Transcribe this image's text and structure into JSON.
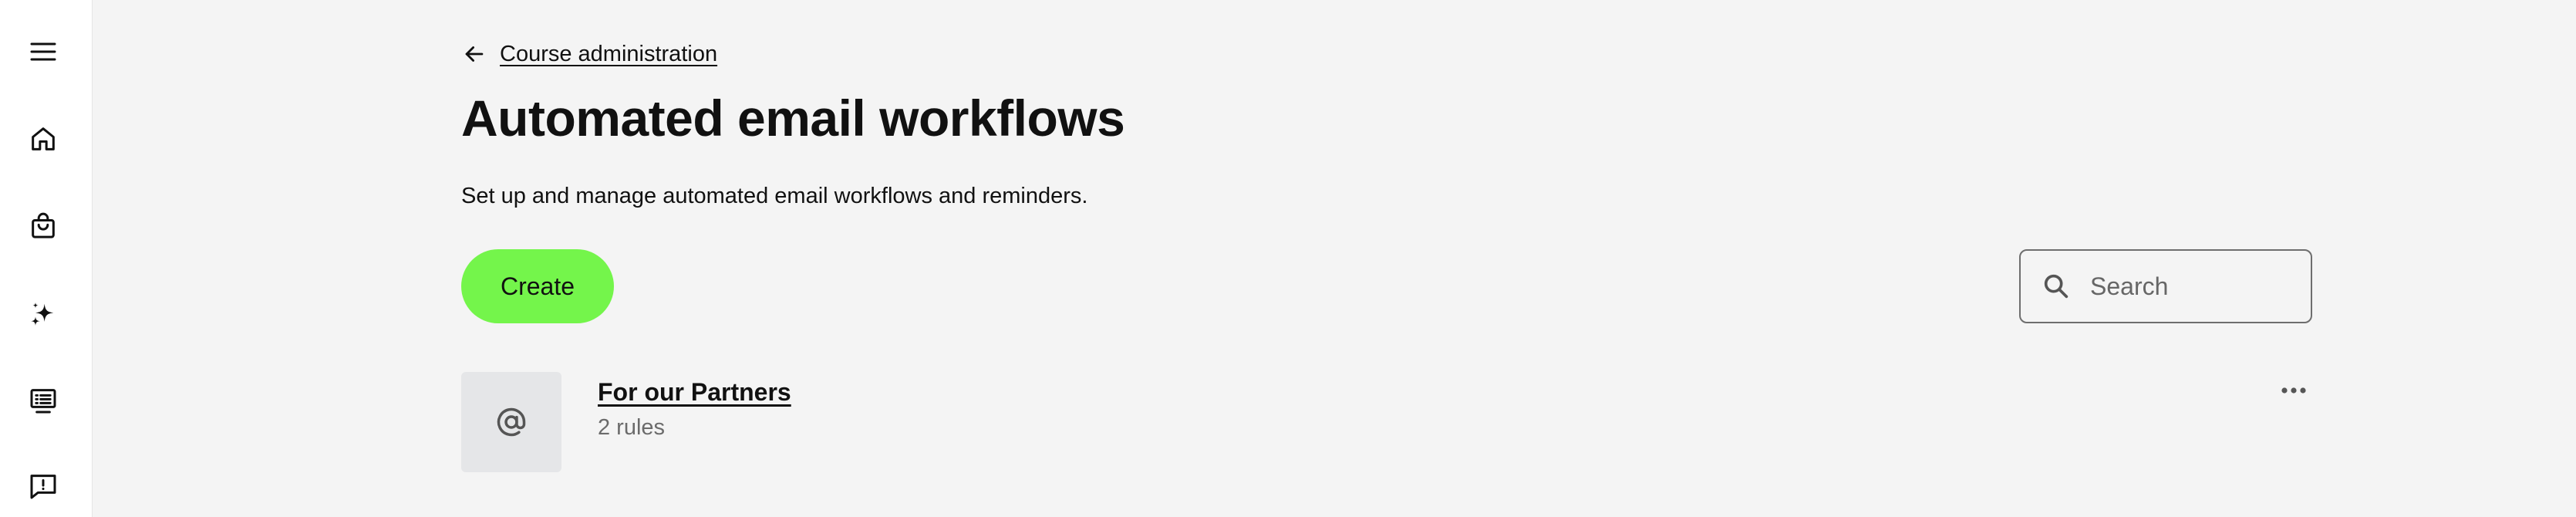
{
  "sidebar": {
    "items": [
      {
        "icon": "menu-icon",
        "label": "Menu"
      },
      {
        "icon": "home-icon",
        "label": "Home"
      },
      {
        "icon": "shopping-bag-icon",
        "label": "Shop"
      },
      {
        "icon": "sparkles-icon",
        "label": "AI"
      },
      {
        "icon": "course-list-icon",
        "label": "Courses"
      },
      {
        "icon": "feedback-icon",
        "label": "Feedback"
      }
    ]
  },
  "header": {
    "back_icon": "arrow-left-icon",
    "back_label": "Course administration",
    "title": "Automated email workflows",
    "subtitle": "Set up and manage automated email workflows and reminders."
  },
  "toolbar": {
    "create_label": "Create",
    "create_color": "#74f54b",
    "search_icon": "search-icon",
    "search_placeholder": "Search",
    "search_value": ""
  },
  "workflows": [
    {
      "icon": "at-sign-icon",
      "name": "For our Partners",
      "rules": "2 rules",
      "menu_icon": "more-horizontal-icon"
    }
  ]
}
